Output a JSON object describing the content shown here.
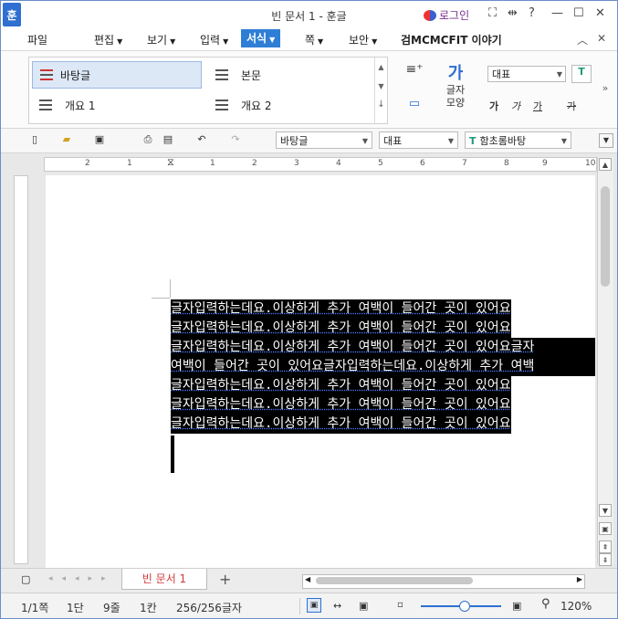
{
  "window": {
    "title": "빈 문서 1 - 훈글",
    "app_icon": "훈",
    "login_label": "로그인",
    "controls": [
      "⛶",
      "⇹",
      "?",
      "—",
      "☐",
      "✕"
    ]
  },
  "menubar": {
    "items": [
      {
        "label": "파일",
        "caret": false
      },
      {
        "label": "편집",
        "caret": true
      },
      {
        "label": "보기",
        "caret": true
      },
      {
        "label": "입력",
        "caret": true
      },
      {
        "label": "서식",
        "caret": true,
        "active": true
      },
      {
        "label": "쪽",
        "caret": true
      },
      {
        "label": "보안",
        "caret": true
      }
    ],
    "trailing_text": "검MCMCFIT 이야기",
    "collapse_icon": "︿",
    "close_icon": "✕"
  },
  "ribbon": {
    "styles": [
      {
        "label": "바탕글",
        "selected": true
      },
      {
        "label": "본문",
        "selected": false
      },
      {
        "label": "개요 1",
        "selected": false
      },
      {
        "label": "개요 2",
        "selected": false
      }
    ],
    "char_shape_label": "글자\n모양",
    "char_shape_icon": "가",
    "font_select": "대표",
    "text_style_buttons": [
      "가",
      "가",
      "가",
      "가"
    ]
  },
  "toolbar": {
    "style_select": "바탕글",
    "lang_select": "대표",
    "font_select": "함초롬바탕"
  },
  "ruler": {
    "ticks": [
      "2",
      "1",
      "1",
      "2",
      "3",
      "4",
      "5",
      "6",
      "7",
      "8",
      "9",
      "10",
      "1"
    ]
  },
  "document": {
    "lines": [
      "글자입력하는데요.이상하게 추가 여백이 들어간 곳이 있어요",
      "글자입력하는데요.이상하게 추가 여백이 들어간 곳이 있어요",
      "글자입력하는데요.이상하게 추가 여백이 들어간 곳이 있어요글자",
      "여백이 들어간 곳이 있어요글자입력하는데요.이상하게 추가 여백",
      "글자입력하는데요.이상하게 추가 여백이 들어간 곳이 있어요",
      "글자입력하는데요.이상하게 추가 여백이 들어간 곳이 있어요",
      "글자입력하는데요.이상하게 추가 여백이 들어간 곳이 있어요"
    ]
  },
  "tabs": {
    "doc_tab": "빈 문서 1",
    "add_tab": "+"
  },
  "status": {
    "page": "1/1쪽",
    "column": "1단",
    "line": "9줄",
    "col": "1칸",
    "chars": "256/256글자",
    "zoom": "120%"
  },
  "colors": {
    "accent": "#2e7ed6",
    "selection": "#000000",
    "tab_text": "#d23a3a"
  }
}
